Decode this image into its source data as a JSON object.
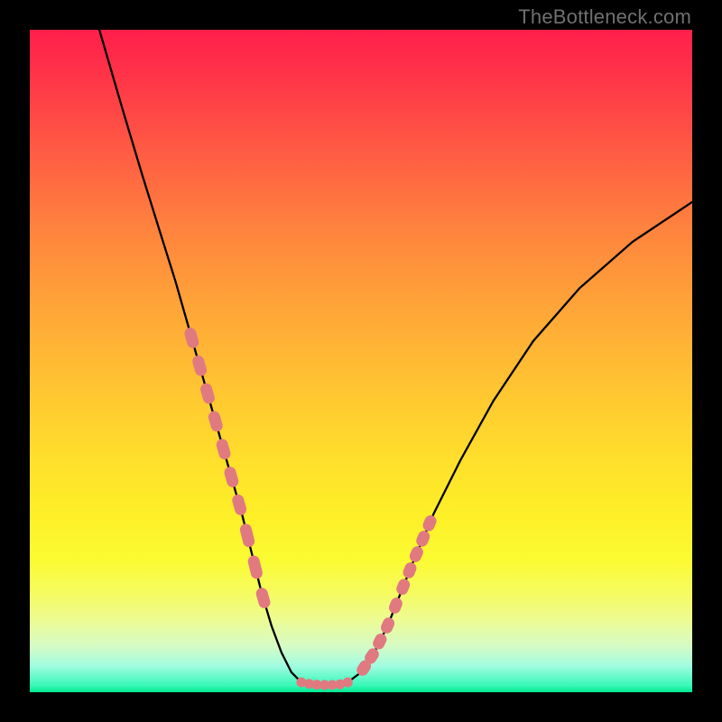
{
  "watermark": "TheBottleneck.com",
  "chart_data": {
    "type": "line",
    "title": "",
    "xlabel": "",
    "ylabel": "",
    "xlim": [
      0,
      100
    ],
    "ylim": [
      0,
      100
    ],
    "series": [
      {
        "name": "curve-left",
        "x": [
          10.5,
          14,
          17,
          19.5,
          22,
          24,
          26,
          28,
          30,
          32,
          33.5,
          35,
          36.5,
          38,
          39.5,
          41
        ],
        "values": [
          100,
          88,
          78,
          70,
          62,
          55,
          48,
          41,
          34,
          27,
          21,
          15,
          10,
          6,
          3,
          1.5
        ]
      },
      {
        "name": "curve-right",
        "x": [
          48,
          50,
          52,
          54,
          56,
          58,
          61,
          65,
          70,
          76,
          83,
          91,
          100
        ],
        "values": [
          1.5,
          3,
          6,
          10,
          15,
          20,
          27,
          35,
          44,
          53,
          61,
          68,
          74
        ]
      },
      {
        "name": "flat-bottom",
        "x": [
          41,
          42.5,
          44,
          45.5,
          47,
          48
        ],
        "values": [
          1.5,
          1.2,
          1.1,
          1.1,
          1.2,
          1.5
        ]
      }
    ],
    "accent_color": "#e07a80",
    "accent_segments": [
      {
        "branch": "left",
        "x_range": [
          24,
          30
        ],
        "style": "dashed-thick"
      },
      {
        "branch": "left",
        "x_range": [
          30,
          36
        ],
        "style": "dashed-thick"
      },
      {
        "branch": "flat",
        "x_range": [
          41,
          48
        ],
        "style": "dots"
      },
      {
        "branch": "right",
        "x_range": [
          50,
          56
        ],
        "style": "dashed-thick"
      },
      {
        "branch": "right",
        "x_range": [
          56,
          61
        ],
        "style": "dashed-thick"
      }
    ]
  }
}
